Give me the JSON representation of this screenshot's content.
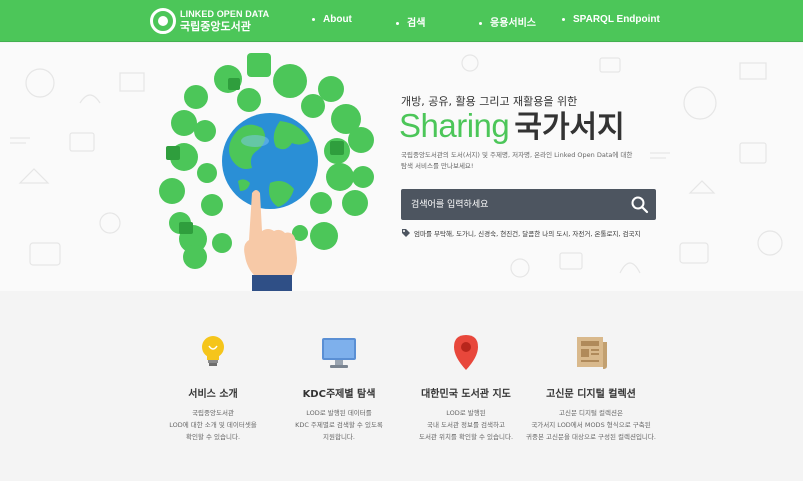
{
  "header": {
    "logo_en": "LINKED OPEN DATA",
    "logo_ko": "국립중앙도서관",
    "nav": [
      "About",
      "검색",
      "응용서비스",
      "SPARQL Endpoint"
    ]
  },
  "hero": {
    "subtitle": "개방, 공유, 활용 그리고 재활용을 위한",
    "title_en": "Sharing",
    "title_ko": "국가서지",
    "desc_lines": [
      "국립중앙도서관의 도서(서지) 및 주제명, 저자명, 온라인 Linked Open Data에 대한",
      "탐색 서비스를 만나보세요!"
    ],
    "search_placeholder": "검색어를 입력하세요",
    "tags": "엄마를 부탁해, 도가니, 신경숙, 현진건, 달콤한 나의 도시, 자전거, 온톨로지, 검국지"
  },
  "features": [
    {
      "icon": "lightbulb-icon",
      "title": "서비스 소개",
      "desc": [
        "국립중앙도서관",
        "LOD에 대한 소개 및 데이터셋을",
        "확인할 수 있습니다."
      ]
    },
    {
      "icon": "monitor-icon",
      "title": "KDC주제별 탐색",
      "desc": [
        "LOD로 발행된 데이터를",
        "KDC 주제별로 검색할 수 있도록",
        "지원합니다."
      ]
    },
    {
      "icon": "map-pin-icon",
      "title": "대한민국 도서관 지도",
      "desc": [
        "LOD로 발행된",
        "국내 도서관 정보를 검색하고",
        "도서관 위치를 확인할 수 있습니다."
      ]
    },
    {
      "icon": "newspaper-icon",
      "title": "고신문 디지털 컬렉션",
      "desc": [
        "고신문 디지털 컬렉션은",
        "국가서지 LOD에서 MODS 형식으로 구축된",
        "귀중본 고신문을 대상으로 구성된 컬렉션입니다."
      ]
    }
  ],
  "colors": {
    "brand_green": "#4cc659",
    "search_bg": "#4d5560"
  }
}
